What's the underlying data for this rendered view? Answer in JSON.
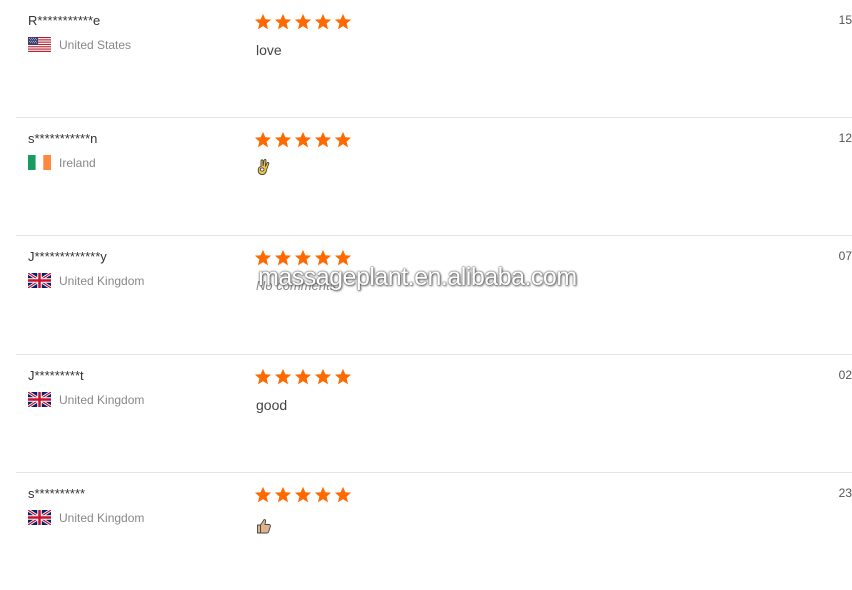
{
  "reviews": [
    {
      "buyer": "R***********e",
      "country": "United States",
      "flag": "us-flag-icon",
      "rating": 5,
      "comment": "love",
      "comment_icon": "",
      "date": "15"
    },
    {
      "buyer": "s***********n",
      "country": "Ireland",
      "flag": "ireland-flag-icon",
      "rating": 5,
      "comment": "",
      "comment_icon": "ok-hand-emoji-icon",
      "date": "12"
    },
    {
      "buyer": "J*************y",
      "country": "United Kingdom",
      "flag": "uk-flag-icon",
      "rating": 5,
      "comment": "No comments",
      "comment_icon": "",
      "date": "07"
    },
    {
      "buyer": "J*********t",
      "country": "United Kingdom",
      "flag": "uk-flag-icon",
      "rating": 5,
      "comment": "good",
      "comment_icon": "",
      "date": "02"
    },
    {
      "buyer": "s**********",
      "country": "United Kingdom",
      "flag": "uk-flag-icon",
      "rating": 5,
      "comment": "",
      "comment_icon": "thumbs-up-emoji-icon",
      "date": "23"
    }
  ],
  "star_color": "#ff6a00",
  "watermark": "massageplant.en.alibaba.com"
}
